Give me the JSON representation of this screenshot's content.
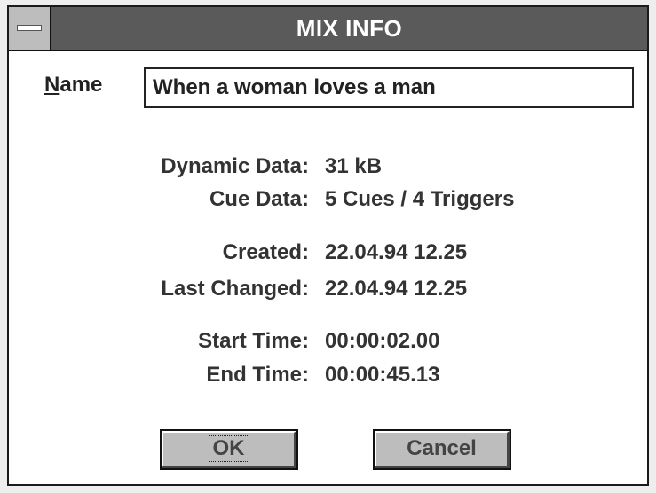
{
  "window": {
    "title": "MIX INFO"
  },
  "name": {
    "label_underlined": "N",
    "label_rest": "ame",
    "value": "When a woman loves a man"
  },
  "info": {
    "dynamic_data": {
      "label": "Dynamic Data:",
      "value": "31 kB"
    },
    "cue_data": {
      "label": "Cue Data:",
      "value": "5 Cues / 4 Triggers"
    },
    "created": {
      "label": "Created:",
      "value": "22.04.94  12.25"
    },
    "last_changed": {
      "label": "Last Changed:",
      "value": "22.04.94  12.25"
    },
    "start_time": {
      "label": "Start Time:",
      "value": "00:00:02.00"
    },
    "end_time": {
      "label": "End Time:",
      "value": "00:00:45.13"
    }
  },
  "buttons": {
    "ok": "OK",
    "cancel": "Cancel"
  },
  "icons": {
    "system_menu": "system-menu-icon"
  }
}
